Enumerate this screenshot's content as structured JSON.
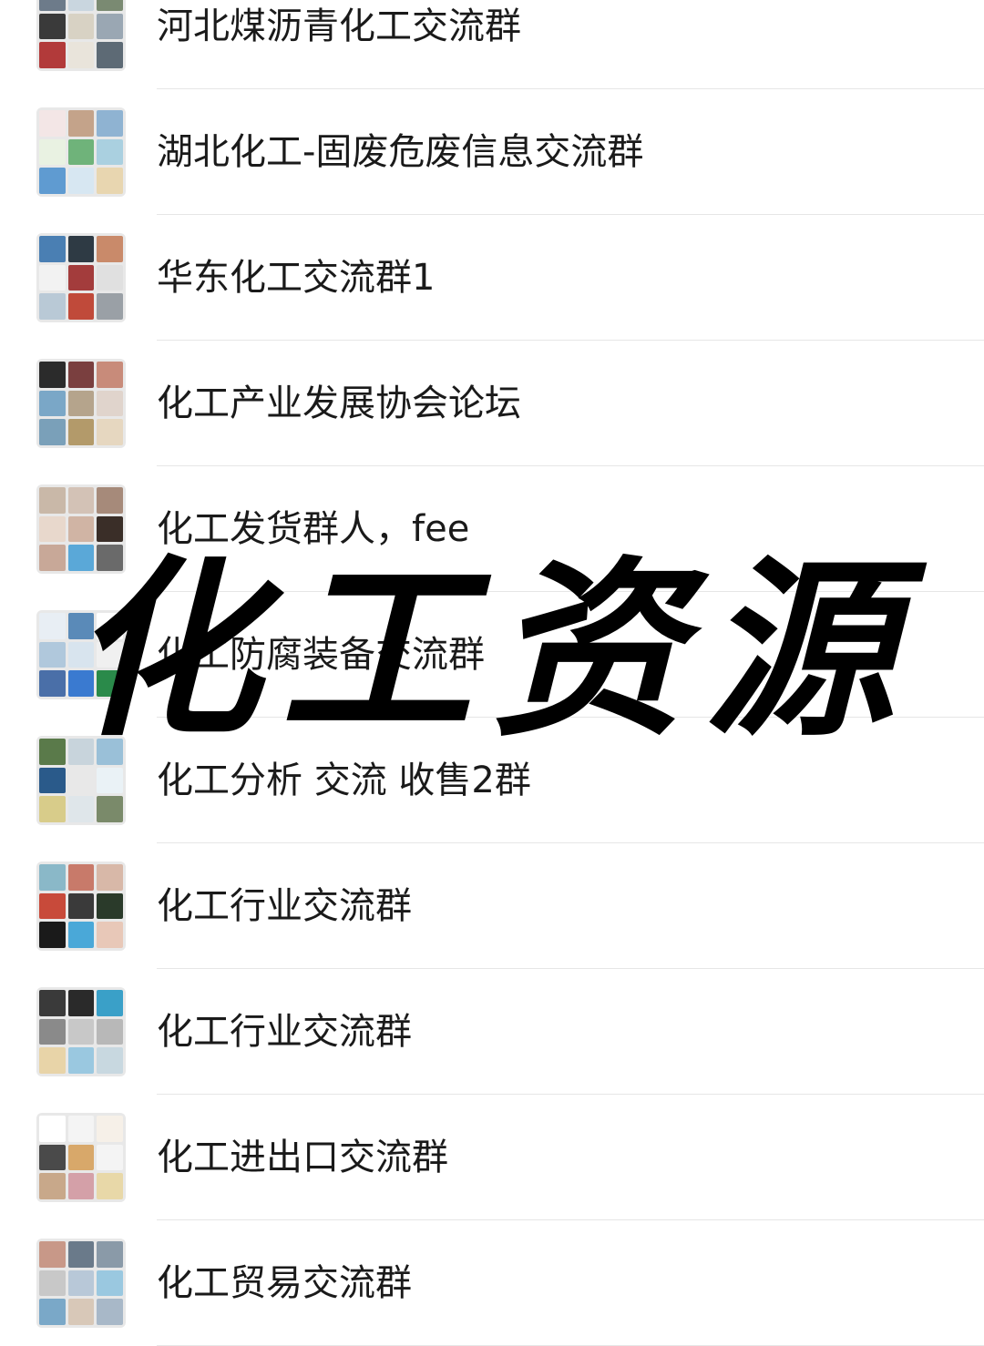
{
  "groups": [
    {
      "name": "河北煤沥青化工交流群",
      "tiles": [
        "#6d7b8a",
        "#c9d6df",
        "#7a8a72",
        "#3a3a3a",
        "#d8d2c4",
        "#9aa7b3",
        "#b23a3a",
        "#e9e4db",
        "#5d6a75"
      ]
    },
    {
      "name": "湖北化工-固废危废信息交流群",
      "tiles": [
        "#f3e6e6",
        "#c4a38a",
        "#8fb3d2",
        "#e9f2e2",
        "#6fb37a",
        "#aad0e0",
        "#5f9bd1",
        "#d7e7f2",
        "#e8d6b0"
      ]
    },
    {
      "name": "华东化工交流群1",
      "tiles": [
        "#4a7fb3",
        "#2e3a44",
        "#c98a6a",
        "#f2f2f2",
        "#a33c3c",
        "#e0e0e0",
        "#b9c9d6",
        "#c04a3a",
        "#9aa0a6"
      ]
    },
    {
      "name": "化工产业发展协会论坛",
      "tiles": [
        "#2b2b2b",
        "#7a3f3f",
        "#c88b7a",
        "#7aa7c7",
        "#b5a48c",
        "#e0d4cc",
        "#7aa0b9",
        "#b39a6a",
        "#e6d7c0"
      ]
    },
    {
      "name": "化工发货群人，fee",
      "tiles": [
        "#c9b8a8",
        "#d3c2b6",
        "#a68a7a",
        "#e8d8cc",
        "#d0b4a4",
        "#3a2e28",
        "#c8a898",
        "#5aa8d8",
        "#6a6a6a"
      ]
    },
    {
      "name": "化工防腐装备交流群",
      "tiles": [
        "#e8eef4",
        "#5a8ab8",
        "#ffffff",
        "#b0c8dc",
        "#d8e4ee",
        "#f0f0f0",
        "#4a6fa8",
        "#3a7ad0",
        "#2a8a4a"
      ]
    },
    {
      "name": "化工分析 交流 收售2群",
      "tiles": [
        "#5a7a4a",
        "#c8d4dc",
        "#9ac0d8",
        "#2a5a8a",
        "#e8e8e8",
        "#eaf2f6",
        "#d8cc8a",
        "#dfe6ea",
        "#7a8a6a"
      ]
    },
    {
      "name": "化工行业交流群",
      "tiles": [
        "#8ab8c8",
        "#c87a6a",
        "#d8b8a8",
        "#c84a3a",
        "#3a3a3a",
        "#2a3a2a",
        "#1a1a1a",
        "#4aa8d8",
        "#e8c8b8"
      ]
    },
    {
      "name": "化工行业交流群",
      "tiles": [
        "#3a3a3a",
        "#2a2a2a",
        "#3aa0c8",
        "#8a8a8a",
        "#c8c8c8",
        "#b8b8b8",
        "#e8d4a8",
        "#9ac8e0",
        "#c8d8e0"
      ]
    },
    {
      "name": "化工进出口交流群",
      "tiles": [
        "#ffffff",
        "#f4f4f4",
        "#f6f0e8",
        "#4a4a4a",
        "#d8a86a",
        "#f4f4f4",
        "#c8a88a",
        "#d4a0a8",
        "#e8d8a8"
      ]
    },
    {
      "name": "化工贸易交流群",
      "tiles": [
        "#c89888",
        "#6a7a8a",
        "#8a9aa8",
        "#c8c8c8",
        "#b8c8d8",
        "#9ac8e0",
        "#7aa8c8",
        "#d8c8b8",
        "#a8b8c8"
      ]
    }
  ],
  "overlay_title": "化工资源"
}
